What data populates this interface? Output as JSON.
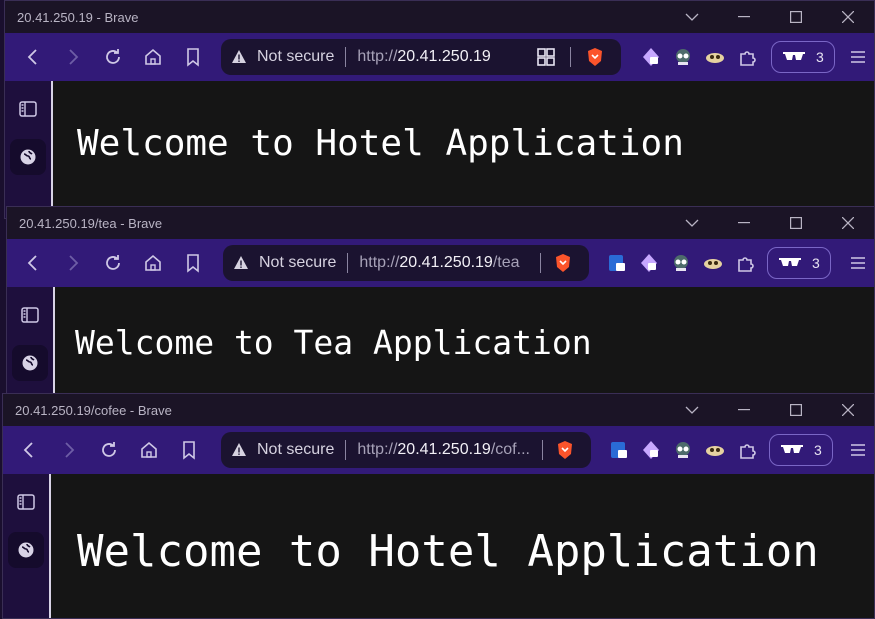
{
  "windows": [
    {
      "title": "20.41.250.19 - Brave",
      "not_secure": "Not secure",
      "url_proto": "http://",
      "url_host": "20.41.250.19",
      "url_path": "",
      "incognito_count": "3",
      "heading": "Welcome to Hotel Application"
    },
    {
      "title": "20.41.250.19/tea - Brave",
      "not_secure": "Not secure",
      "url_proto": "http://",
      "url_host": "20.41.250.19",
      "url_path": "/tea",
      "incognito_count": "3",
      "heading": "Welcome to Tea Application"
    },
    {
      "title": "20.41.250.19/cofee - Brave",
      "not_secure": "Not secure",
      "url_proto": "http://",
      "url_host": "20.41.250.19",
      "url_path": "/cof...",
      "incognito_count": "3",
      "heading": "Welcome to Hotel Application"
    }
  ],
  "colors": {
    "toolbar": "#321a78",
    "titlebar": "#1b1426",
    "page_bg": "#151515",
    "brave_orange": "#fb542b"
  }
}
